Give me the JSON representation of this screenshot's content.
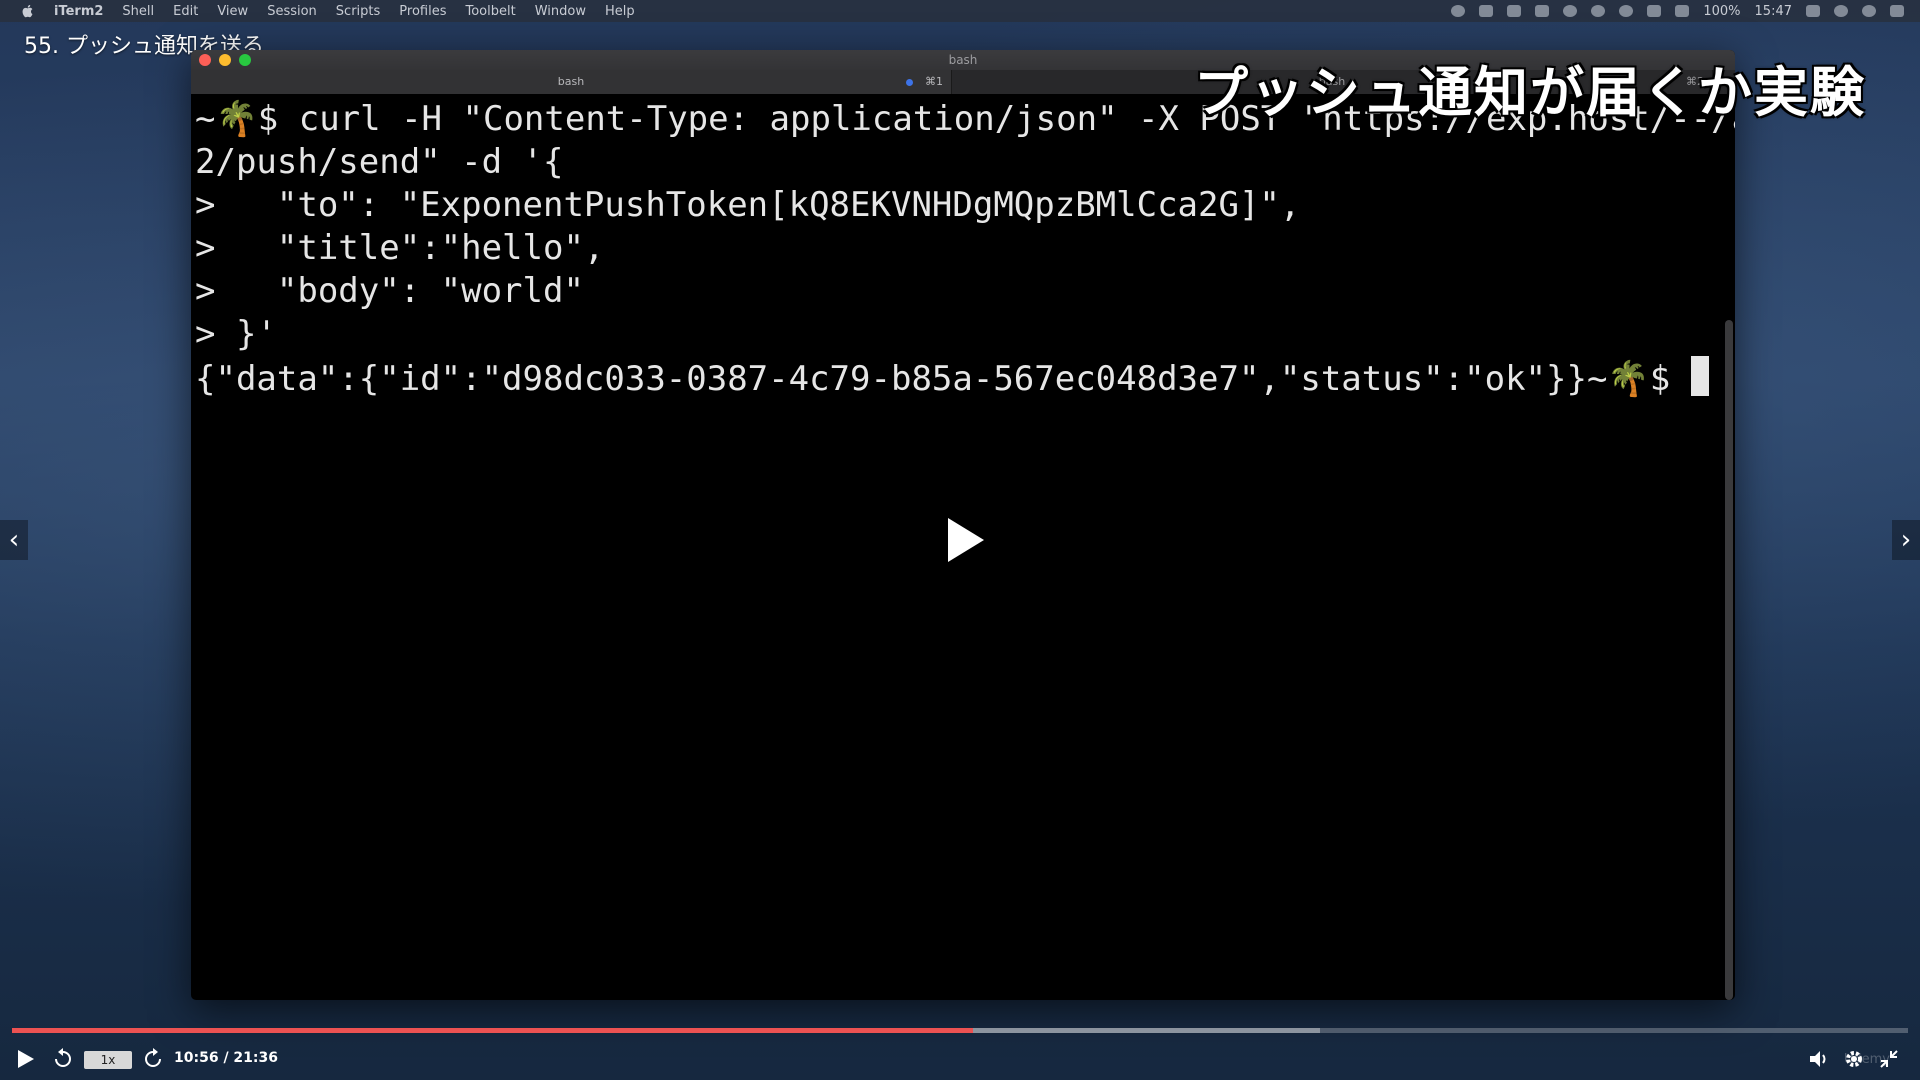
{
  "menubar": {
    "app": "iTerm2",
    "items": [
      "Shell",
      "Edit",
      "View",
      "Session",
      "Scripts",
      "Profiles",
      "Toolbelt",
      "Window",
      "Help"
    ],
    "battery": "100%",
    "clock": "15:47"
  },
  "lesson_title": "55. プッシュ通知を送る",
  "window": {
    "title": "bash",
    "tabs": [
      {
        "label": "bash",
        "shortcut": "⌘1"
      },
      {
        "label": "bash",
        "shortcut": "⌘2"
      }
    ]
  },
  "terminal": {
    "lines": [
      "~🌴$ curl -H \"Content-Type: application/json\" -X POST \"https://exp.host/--/api/v",
      "2/push/send\" -d '{",
      ">   \"to\": \"ExponentPushToken[kQ8EKVNHDgMQpzBMlCca2G]\",",
      ">   \"title\":\"hello\",",
      ">   \"body\": \"world\"",
      "> }'",
      "{\"data\":{\"id\":\"d98dc033-0387-4c79-b85a-567ec048d3e7\",\"status\":\"ok\"}}~🌴$ "
    ]
  },
  "overlay_caption": "プッシュ通知が届くか実験",
  "player": {
    "speed": "1x",
    "time": "10:56 / 21:36",
    "progress_fraction": 0.5067,
    "buffered_fraction": 0.69,
    "brand": "Udemy",
    "accent_color": "#ec5252"
  }
}
